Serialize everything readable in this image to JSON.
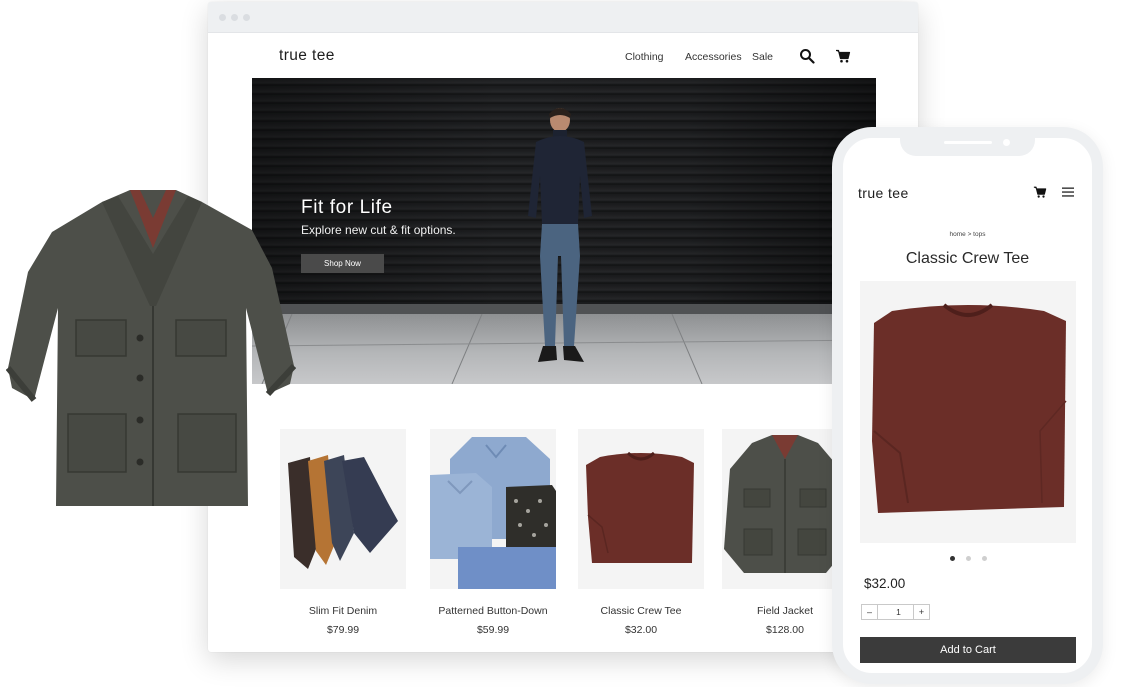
{
  "desktop": {
    "logo": "true tee",
    "nav": [
      "Clothing",
      "Accessories",
      "Sale"
    ],
    "icons": {
      "search": "search-icon",
      "cart": "cart-icon"
    },
    "hero": {
      "title": "Fit for Life",
      "subtitle": "Explore new cut & fit options.",
      "cta": "Shop Now"
    },
    "products": [
      {
        "name": "Slim Fit Denim",
        "price": "$79.99"
      },
      {
        "name": "Patterned Button-Down",
        "price": "$59.99"
      },
      {
        "name": "Classic Crew Tee",
        "price": "$32.00"
      },
      {
        "name": "Field Jacket",
        "price": "$128.00"
      }
    ]
  },
  "mobile": {
    "logo": "true tee",
    "icons": {
      "cart": "cart-icon",
      "menu": "hamburger-menu-icon"
    },
    "breadcrumb": "home > tops",
    "product_title": "Classic Crew Tee",
    "price": "$32.00",
    "quantity": {
      "decrement": "–",
      "value": "1",
      "increment": "+"
    },
    "add_to_cart": "Add to Cart",
    "carousel": {
      "count": 3,
      "active": 1
    }
  },
  "colors": {
    "button_dark": "#3b3b3b",
    "tee_maroon": "#6b2e28",
    "jacket_olive": "#4d4f49",
    "frame_gray": "#eef0f2"
  }
}
